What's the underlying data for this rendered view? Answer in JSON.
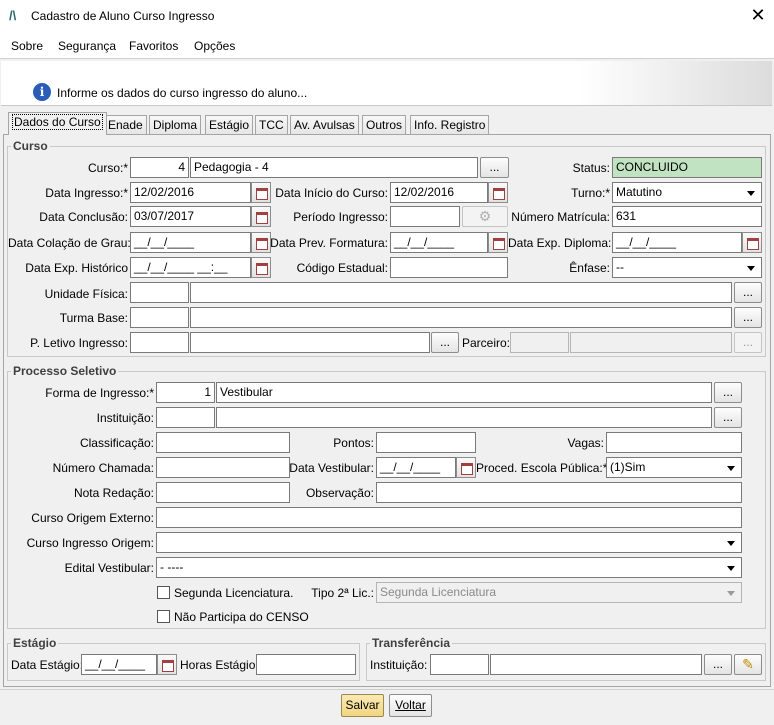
{
  "window": {
    "title": "Cadastro de Aluno Curso Ingresso"
  },
  "menu": [
    "Sobre",
    "Segurança",
    "Favoritos",
    "Opções"
  ],
  "info": {
    "message": "Informe os dados do curso ingresso do aluno..."
  },
  "tabs": [
    "Dados do Curso",
    "Enade",
    "Diploma",
    "Estágio",
    "TCC",
    "Av. Avulsas",
    "Outros",
    "Info. Registro"
  ],
  "curso": {
    "group_title": "Curso",
    "curso_label": "Curso:*",
    "curso_code": "4",
    "curso_name": "Pedagogia - 4",
    "status_label": "Status:",
    "status_value": "CONCLUIDO",
    "data_ingresso_label": "Data Ingresso:*",
    "data_ingresso": "12/02/2016",
    "data_inicio_label": "Data Início do Curso:",
    "data_inicio": "12/02/2016",
    "turno_label": "Turno:*",
    "turno_value": "Matutino",
    "data_conclusao_label": "Data Conclusão:",
    "data_conclusao": "03/07/2017",
    "periodo_ingresso_label": "Período Ingresso:",
    "periodo_ingresso": "",
    "numero_matricula_label": "Número Matrícula:",
    "numero_matricula": "631",
    "data_colacao_label": "Data Colação de Grau:",
    "data_colacao": "__/__/____",
    "data_prev_formatura_label": "Data Prev. Formatura:",
    "data_prev_formatura": "__/__/____",
    "data_exp_diploma_label": "Data Exp. Diploma:",
    "data_exp_diploma": "__/__/____",
    "data_exp_historico_label": "Data Exp. Histórico",
    "data_exp_historico": "__/__/____ __:__",
    "codigo_estadual_label": "Código Estadual:",
    "codigo_estadual": "",
    "enfase_label": "Ênfase:",
    "enfase_value": "--",
    "unidade_fisica_label": "Unidade Física:",
    "turma_base_label": "Turma Base:",
    "p_letivo_label": "P. Letivo Ingresso:",
    "parceiro_label": "Parceiro:"
  },
  "processo": {
    "group_title": "Processo Seletivo",
    "forma_label": "Forma de Ingresso:*",
    "forma_code": "1",
    "forma_name": "Vestibular",
    "instituicao_label": "Instituição:",
    "classificacao_label": "Classificação:",
    "pontos_label": "Pontos:",
    "vagas_label": "Vagas:",
    "numero_chamada_label": "Número Chamada:",
    "data_vestibular_label": "Data Vestibular:",
    "data_vestibular": "__/__/____",
    "proced_label": "Proced. Escola Pública:*",
    "proced_value": "(1)Sim",
    "nota_redacao_label": "Nota Redação:",
    "observacao_label": "Observação:",
    "curso_origem_externo_label": "Curso Origem Externo:",
    "curso_ingresso_origem_label": "Curso Ingresso Origem:",
    "edital_label": "Edital Vestibular:",
    "edital_value": "- ----",
    "segunda_licenciatura_label": "Segunda Licenciatura.",
    "tipo2_label": "Tipo 2ª Lic.:",
    "tipo2_value": "Segunda Licenciatura",
    "censo_label": "Não Participa do CENSO"
  },
  "estagio": {
    "group_title": "Estágio",
    "data_label": "Data Estágio:",
    "data_value": "__/__/____",
    "horas_label": "Horas Estágio:"
  },
  "transferencia": {
    "group_title": "Transferência",
    "instituicao_label": "Instituição:"
  },
  "footer": {
    "save_label": "Salvar",
    "back_label": "Voltar"
  },
  "ellipsis": "...",
  "colors": {
    "status_bg": "#c1e3c1",
    "info_icon": "#2a5cb8",
    "save_button": "#f5df9a"
  }
}
